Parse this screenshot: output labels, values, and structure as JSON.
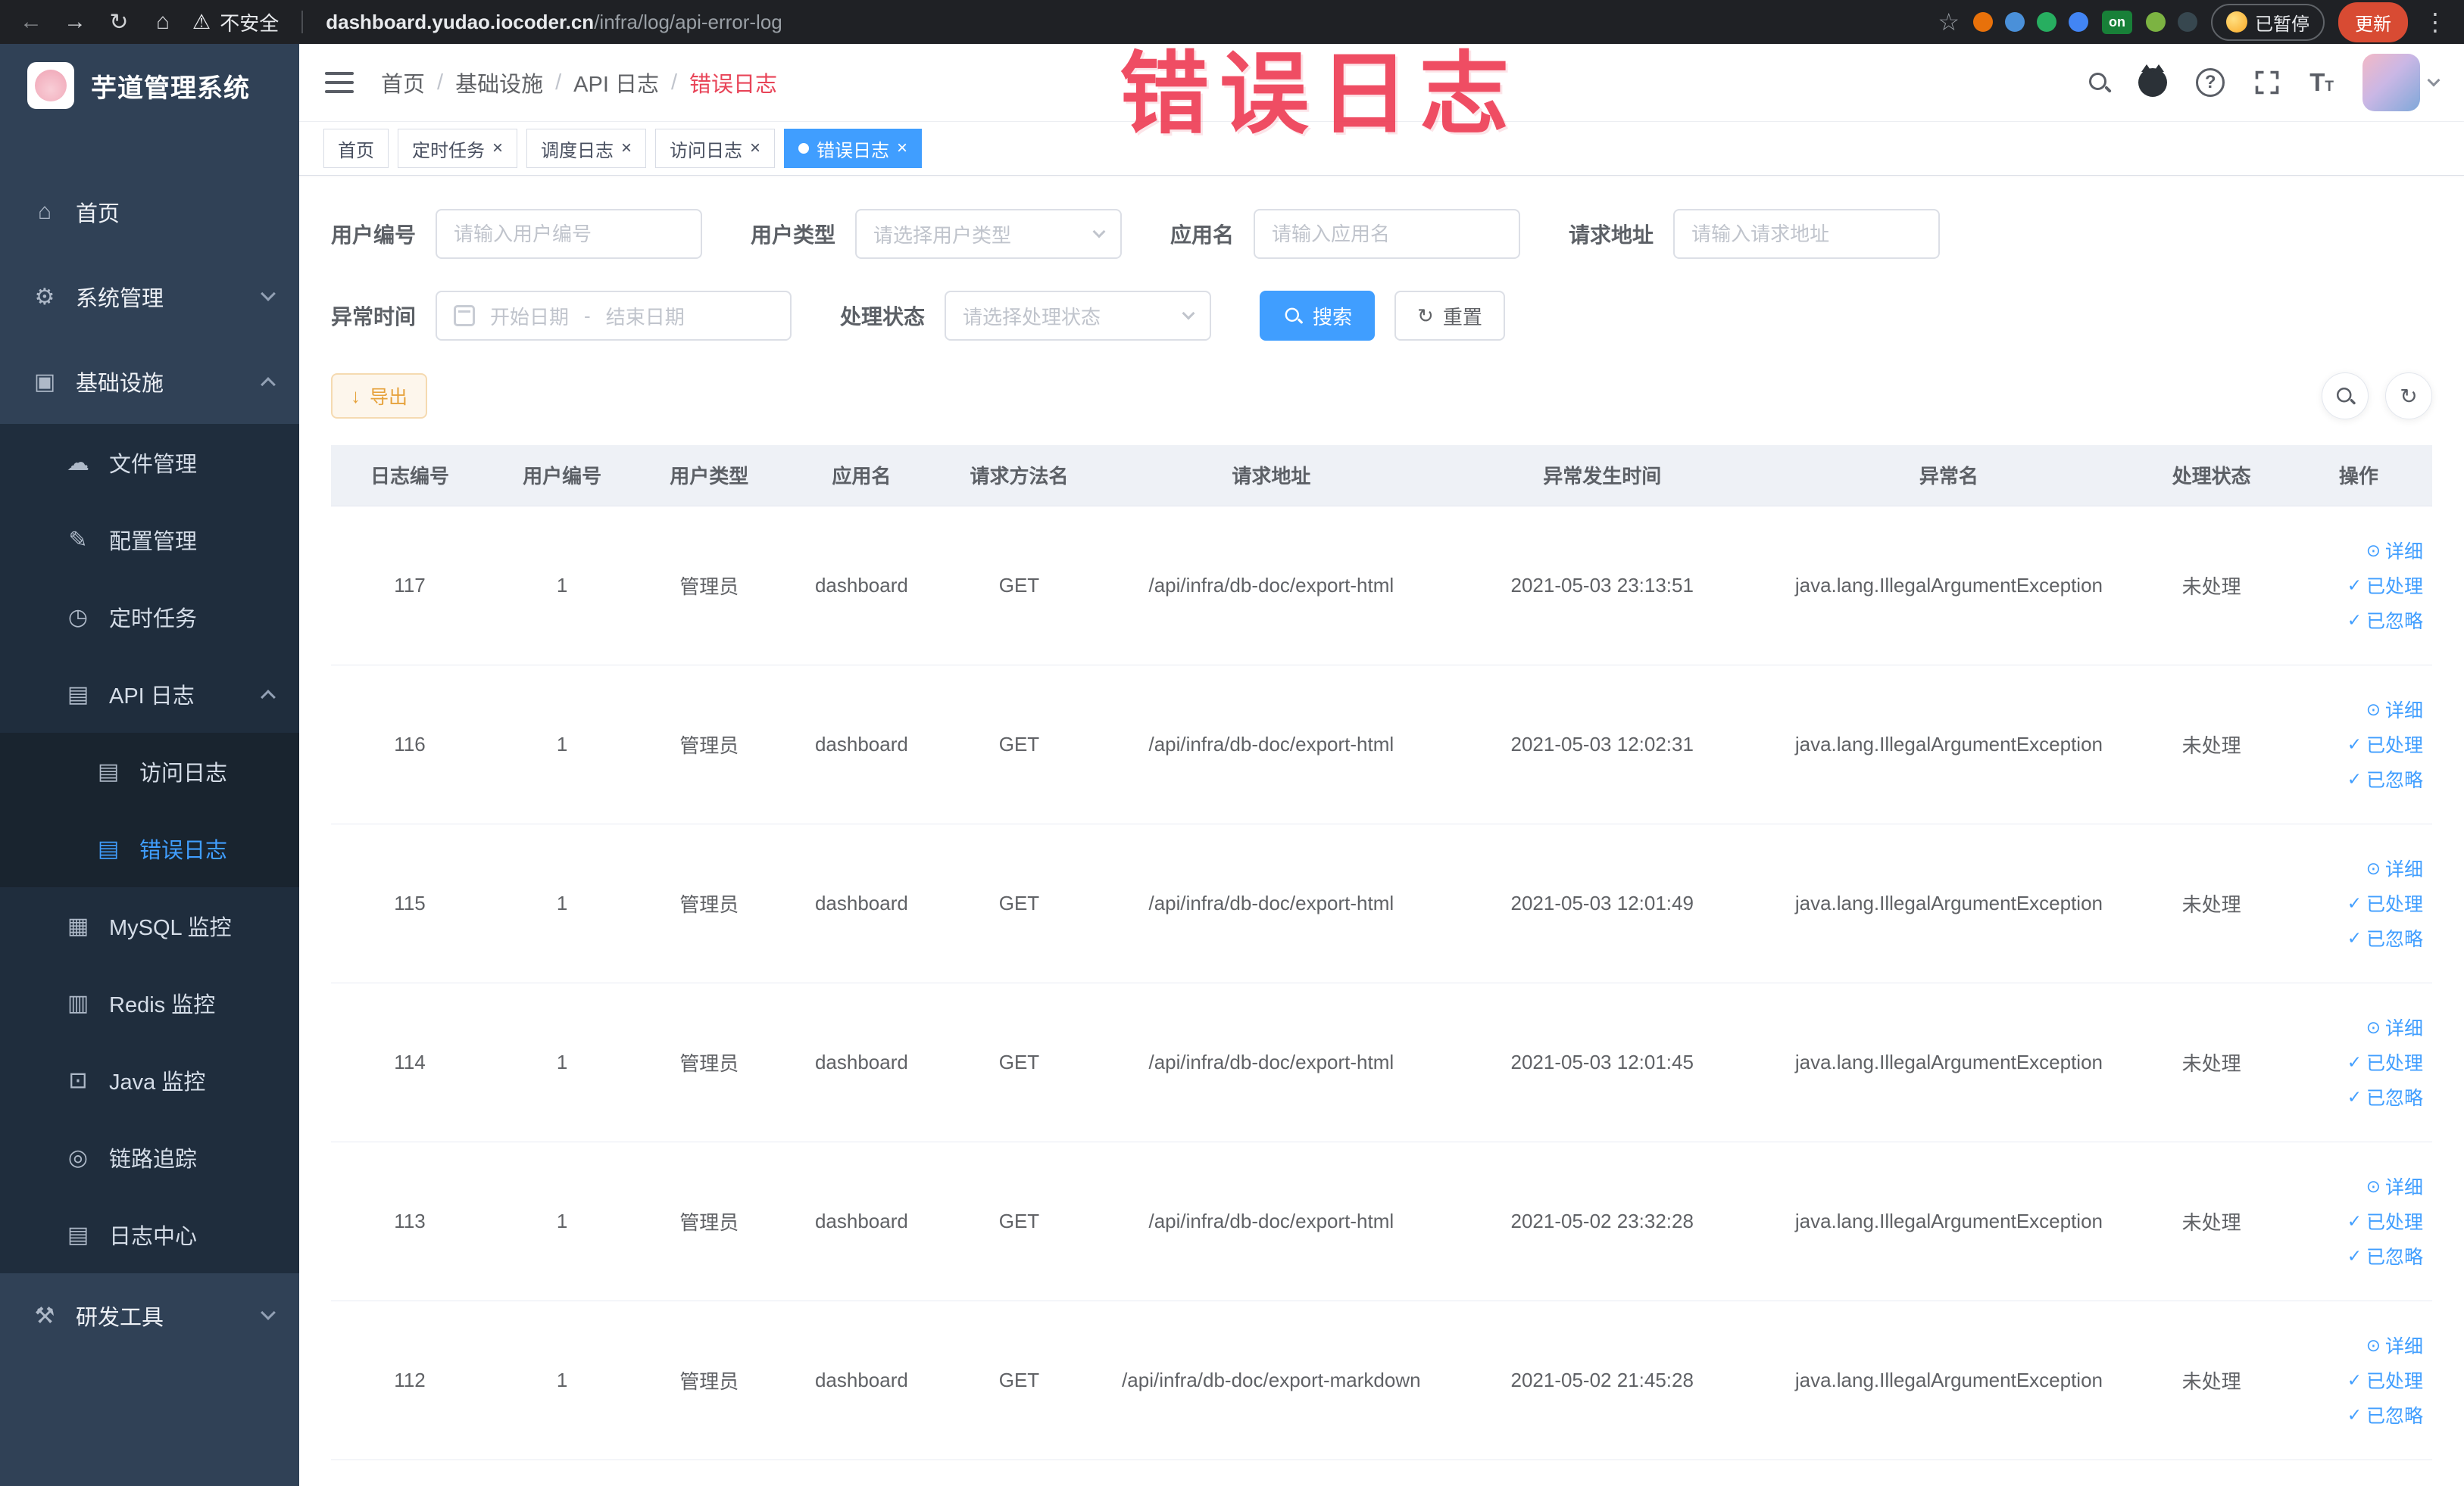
{
  "browser": {
    "security_label": "不安全",
    "url_host": "dashboard.yudao.iocoder.cn",
    "url_path": "/infra/log/api-error-log",
    "extension_colors_before_on": [
      "#e8710a",
      "#4a90d9",
      "#27ae60",
      "#4285f4"
    ],
    "extensions_on_badge": "on",
    "extension_colors_after_on": [
      "#7cb342",
      "#37474f"
    ],
    "paused_badge": "已暂停",
    "update_button": "更新"
  },
  "watermark": "错误日志",
  "sidebar": {
    "logo_title": "芋道管理系统",
    "menu": [
      {
        "label": "首页",
        "icon": "home-icon",
        "glyph": "⌂",
        "level": 1
      },
      {
        "label": "系统管理",
        "icon": "gear-icon",
        "glyph": "⚙",
        "level": 1,
        "chevron": "down"
      },
      {
        "label": "基础设施",
        "icon": "infrastructure-icon",
        "glyph": "▣",
        "level": 1,
        "chevron": "up"
      },
      {
        "label": "文件管理",
        "icon": "file-manage-icon",
        "glyph": "☁",
        "level": 2
      },
      {
        "label": "配置管理",
        "icon": "config-manage-icon",
        "glyph": "✎",
        "level": 2
      },
      {
        "label": "定时任务",
        "icon": "scheduled-job-icon",
        "glyph": "◷",
        "level": 2
      },
      {
        "label": "API 日志",
        "icon": "api-log-icon",
        "glyph": "▤",
        "level": 2,
        "chevron": "up"
      },
      {
        "label": "访问日志",
        "icon": "access-log-icon",
        "glyph": "▤",
        "level": 3
      },
      {
        "label": "错误日志",
        "icon": "error-log-icon",
        "glyph": "▤",
        "level": 3,
        "active": true
      },
      {
        "label": "MySQL 监控",
        "icon": "mysql-monitor-icon",
        "glyph": "▦",
        "level": 2
      },
      {
        "label": "Redis 监控",
        "icon": "redis-monitor-icon",
        "glyph": "▥",
        "level": 2
      },
      {
        "label": "Java 监控",
        "icon": "java-monitor-icon",
        "glyph": "⊡",
        "level": 2
      },
      {
        "label": "链路追踪",
        "icon": "trace-icon",
        "glyph": "◎",
        "level": 2
      },
      {
        "label": "日志中心",
        "icon": "log-center-icon",
        "glyph": "▤",
        "level": 2
      },
      {
        "label": "研发工具",
        "icon": "dev-tools-icon",
        "glyph": "⚒",
        "level": 1,
        "chevron": "down"
      }
    ]
  },
  "header": {
    "breadcrumb": [
      "首页",
      "基础设施",
      "API 日志",
      "错误日志"
    ]
  },
  "tabs": [
    {
      "label": "首页",
      "closable": false,
      "active": false
    },
    {
      "label": "定时任务",
      "closable": true,
      "active": false
    },
    {
      "label": "调度日志",
      "closable": true,
      "active": false
    },
    {
      "label": "访问日志",
      "closable": true,
      "active": false
    },
    {
      "label": "错误日志",
      "closable": true,
      "active": true
    }
  ],
  "filters": {
    "user_id": {
      "label": "用户编号",
      "placeholder": "请输入用户编号"
    },
    "user_type": {
      "label": "用户类型",
      "placeholder": "请选择用户类型"
    },
    "app_name": {
      "label": "应用名",
      "placeholder": "请输入应用名"
    },
    "request_url": {
      "label": "请求地址",
      "placeholder": "请输入请求地址"
    },
    "exception_time": {
      "label": "异常时间",
      "start_placeholder": "开始日期",
      "separator": "-",
      "end_placeholder": "结束日期"
    },
    "process_status": {
      "label": "处理状态",
      "placeholder": "请选择处理状态"
    },
    "search_button": "搜索",
    "reset_button": "重置"
  },
  "toolbar": {
    "export_button": "导出"
  },
  "table": {
    "columns": [
      "日志编号",
      "用户编号",
      "用户类型",
      "应用名",
      "请求方法名",
      "请求地址",
      "异常发生时间",
      "异常名",
      "处理状态",
      "操作"
    ],
    "actions": [
      "详细",
      "已处理",
      "已忽略"
    ],
    "rows": [
      {
        "id": "117",
        "user_id": "1",
        "user_type": "管理员",
        "app_name": "dashboard",
        "method": "GET",
        "url": "/api/infra/db-doc/export-html",
        "time": "2021-05-03 23:13:51",
        "exception": "java.lang.IllegalArgumentException",
        "status": "未处理"
      },
      {
        "id": "116",
        "user_id": "1",
        "user_type": "管理员",
        "app_name": "dashboard",
        "method": "GET",
        "url": "/api/infra/db-doc/export-html",
        "time": "2021-05-03 12:02:31",
        "exception": "java.lang.IllegalArgumentException",
        "status": "未处理"
      },
      {
        "id": "115",
        "user_id": "1",
        "user_type": "管理员",
        "app_name": "dashboard",
        "method": "GET",
        "url": "/api/infra/db-doc/export-html",
        "time": "2021-05-03 12:01:49",
        "exception": "java.lang.IllegalArgumentException",
        "status": "未处理"
      },
      {
        "id": "114",
        "user_id": "1",
        "user_type": "管理员",
        "app_name": "dashboard",
        "method": "GET",
        "url": "/api/infra/db-doc/export-html",
        "time": "2021-05-03 12:01:45",
        "exception": "java.lang.IllegalArgumentException",
        "status": "未处理"
      },
      {
        "id": "113",
        "user_id": "1",
        "user_type": "管理员",
        "app_name": "dashboard",
        "method": "GET",
        "url": "/api/infra/db-doc/export-html",
        "time": "2021-05-02 23:32:28",
        "exception": "java.lang.IllegalArgumentException",
        "status": "未处理"
      },
      {
        "id": "112",
        "user_id": "1",
        "user_type": "管理员",
        "app_name": "dashboard",
        "method": "GET",
        "url": "/api/infra/db-doc/export-markdown",
        "time": "2021-05-02 21:45:28",
        "exception": "java.lang.IllegalArgumentException",
        "status": "未处理"
      }
    ]
  },
  "colors": {
    "accent": "#409EFF",
    "active_tab": "#409EFF",
    "warning": "#E6A23C",
    "watermark_red": "#EE3E56",
    "sidebar_bg": "#304156",
    "submenu_bg": "#1F2D3D"
  }
}
